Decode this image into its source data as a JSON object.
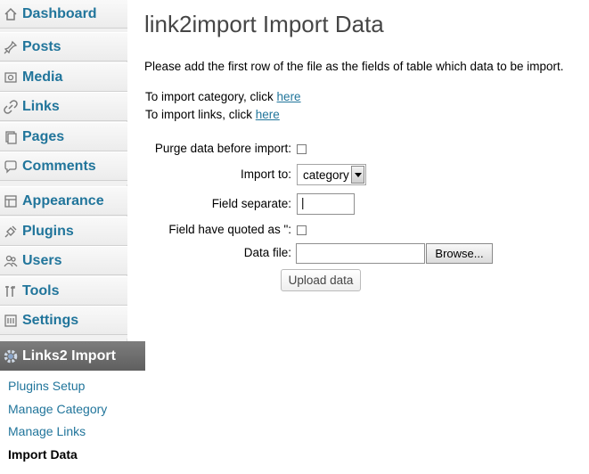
{
  "sidebar": {
    "items": [
      {
        "label": "Dashboard",
        "icon": "dashboard-icon"
      },
      {
        "label": "Posts",
        "icon": "pin-icon"
      },
      {
        "label": "Media",
        "icon": "media-icon"
      },
      {
        "label": "Links",
        "icon": "link-icon"
      },
      {
        "label": "Pages",
        "icon": "pages-icon"
      },
      {
        "label": "Comments",
        "icon": "comments-icon"
      },
      {
        "label": "Appearance",
        "icon": "appearance-icon"
      },
      {
        "label": "Plugins",
        "icon": "plugins-icon"
      },
      {
        "label": "Users",
        "icon": "users-icon"
      },
      {
        "label": "Tools",
        "icon": "tools-icon"
      },
      {
        "label": "Settings",
        "icon": "settings-icon"
      }
    ],
    "active": {
      "label": "Links2 Import",
      "icon": "gear-icon"
    },
    "submenu": [
      "Plugins Setup",
      "Manage Category",
      "Manage Links",
      "Import Data"
    ],
    "current_submenu": "Import Data",
    "link_color": "#21759b"
  },
  "main": {
    "title": "link2import Import Data",
    "intro": "Please add the first row of the file as the fields of table which data to be import.",
    "import_category_prefix": "To import category, click ",
    "import_category_link": "here",
    "import_links_prefix": "To import links, click ",
    "import_links_link": "here",
    "form": {
      "purge_label": "Purge data before import:",
      "import_to_label": "Import to:",
      "import_to_value": "category",
      "field_separate_label": "Field separate:",
      "field_separate_value": "|",
      "quoted_label": "Field have quoted as \":",
      "data_file_label": "Data file:",
      "data_file_value": "",
      "browse_label": "Browse...",
      "upload_label": "Upload data"
    }
  }
}
